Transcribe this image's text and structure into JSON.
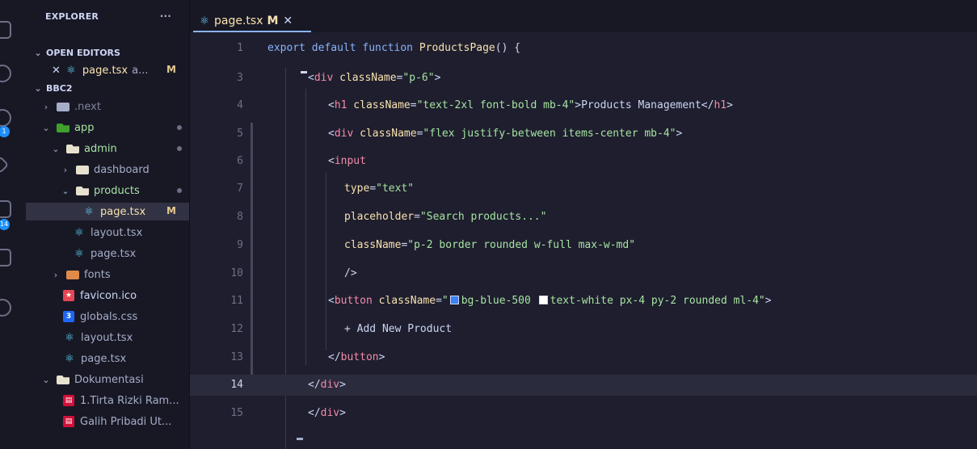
{
  "sidebar": {
    "title": "EXPLORER",
    "menu": "···",
    "open_editors": {
      "label": "OPEN EDITORS",
      "item": {
        "name": "page.tsx",
        "folder": "a...",
        "status": "M"
      }
    },
    "project": "BBC2",
    "tree": [
      {
        "name": ".next",
        "type": "folder"
      },
      {
        "name": "app",
        "type": "folder-open"
      },
      {
        "name": "admin",
        "type": "folder-open"
      },
      {
        "name": "dashboard",
        "type": "folder"
      },
      {
        "name": "products",
        "type": "folder-open"
      },
      {
        "name": "page.tsx",
        "type": "react",
        "status": "M"
      },
      {
        "name": "layout.tsx",
        "type": "react"
      },
      {
        "name": "page.tsx",
        "type": "react"
      },
      {
        "name": "fonts",
        "type": "folder"
      },
      {
        "name": "favicon.ico",
        "type": "ico"
      },
      {
        "name": "globals.css",
        "type": "css"
      },
      {
        "name": "layout.tsx",
        "type": "react"
      },
      {
        "name": "page.tsx",
        "type": "react"
      },
      {
        "name": "Dokumentasi",
        "type": "folder-open"
      },
      {
        "name": "1.Tirta Rizki Ram...",
        "type": "pdf"
      },
      {
        "name": "Galih Pribadi Ut...",
        "type": "pdf"
      }
    ],
    "badges": [
      "1",
      "14"
    ]
  },
  "tab": {
    "name": "page.tsx",
    "status": "M",
    "close": "✕"
  },
  "colors": {
    "accent": "#89b4fa",
    "modified": "#f9e2af",
    "keyword": "#89b4fa",
    "tag": "#f38ba8",
    "string": "#a6e3a1"
  },
  "lines": [
    {
      "n": "1",
      "c": [
        [
          "export default function ",
          "kw"
        ],
        [
          "ProductsPage",
          "fn"
        ],
        [
          "() {",
          "txt"
        ]
      ]
    },
    {
      "n": "3",
      "c": [
        [
          "<",
          "txt"
        ],
        [
          "div",
          "tag"
        ],
        [
          " className",
          "attr"
        ],
        [
          "=",
          "txt"
        ],
        [
          "\"p-6\"",
          "str"
        ],
        [
          ">",
          "txt"
        ]
      ]
    },
    {
      "n": "4",
      "c": [
        [
          "<",
          "txt"
        ],
        [
          "h1",
          "tag"
        ],
        [
          " className",
          "attr"
        ],
        [
          "=",
          "txt"
        ],
        [
          "\"text-2xl font-bold mb-4\"",
          "str"
        ],
        [
          ">Products Management</",
          "txt"
        ],
        [
          "h1",
          "tag"
        ],
        [
          ">",
          "txt"
        ]
      ]
    },
    {
      "n": "5",
      "c": [
        [
          "<",
          "txt"
        ],
        [
          "div",
          "tag"
        ],
        [
          " className",
          "attr"
        ],
        [
          "=",
          "txt"
        ],
        [
          "\"flex justify-between items-center mb-4\"",
          "str"
        ],
        [
          ">",
          "txt"
        ]
      ]
    },
    {
      "n": "6",
      "c": [
        [
          "<",
          "txt"
        ],
        [
          "input",
          "tag"
        ]
      ]
    },
    {
      "n": "7",
      "c": [
        [
          "type",
          "attr"
        ],
        [
          "=",
          "txt"
        ],
        [
          "\"text\"",
          "str"
        ]
      ]
    },
    {
      "n": "8",
      "c": [
        [
          "placeholder",
          "attr"
        ],
        [
          "=",
          "txt"
        ],
        [
          "\"Search products...\"",
          "str"
        ]
      ]
    },
    {
      "n": "9",
      "c": [
        [
          "className",
          "attr"
        ],
        [
          "=",
          "txt"
        ],
        [
          "\"p-2 border rounded w-full max-w-md\"",
          "str"
        ]
      ]
    },
    {
      "n": "10",
      "c": [
        [
          "/>",
          "txt"
        ]
      ]
    },
    {
      "n": "11",
      "c": [
        [
          "<",
          "txt"
        ],
        [
          "button",
          "tag"
        ],
        [
          " className",
          "attr"
        ],
        [
          "=",
          "txt"
        ],
        [
          "\"",
          "str"
        ],
        [
          "#3b82f6",
          "swatch"
        ],
        [
          "bg-blue-500 ",
          "str"
        ],
        [
          "#ffffff",
          "swatch"
        ],
        [
          "text-white px-4 py-2 rounded ml-4\"",
          "str"
        ],
        [
          ">",
          "txt"
        ]
      ]
    },
    {
      "n": "12",
      "c": [
        [
          "+ Add New Product",
          "txt"
        ]
      ]
    },
    {
      "n": "13",
      "c": [
        [
          "</",
          "txt"
        ],
        [
          "button",
          "tag"
        ],
        [
          ">",
          "txt"
        ]
      ]
    },
    {
      "n": "14",
      "c": [
        [
          "</",
          "txt"
        ],
        [
          "div",
          "tag"
        ],
        [
          ">",
          "txt"
        ]
      ]
    },
    {
      "n": "15",
      "c": [
        [
          "</",
          "txt"
        ],
        [
          "div",
          "tag"
        ],
        [
          ">",
          "txt"
        ]
      ]
    }
  ]
}
